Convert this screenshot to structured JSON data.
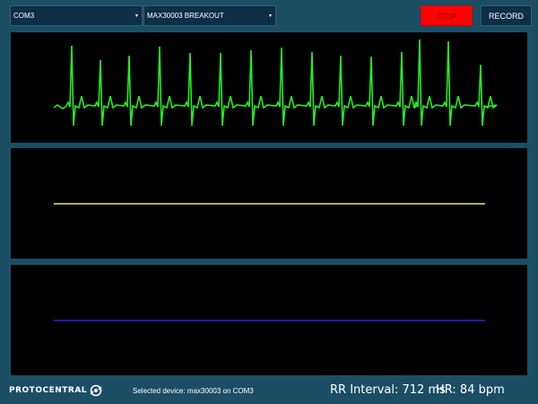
{
  "toolbar": {
    "port_select": {
      "value": "COM3"
    },
    "board_select": {
      "value": "MAX30003 BREAKOUT"
    },
    "stop_label": "STOP",
    "record_label": "RECORD"
  },
  "plots": {
    "ecg_color": "#22ee22",
    "trace2_color": "#e8e85a",
    "trace3_color": "#1a1aa8"
  },
  "footer": {
    "logo_text": "PROTOCENTRAL",
    "status": "Selected device: max30003 on COM3",
    "rr_interval": "RR Interval: 712 ms",
    "heart_rate": "HR: 84 bpm"
  },
  "colors": {
    "background": "#1b4e65",
    "stop_button": "#ff0000",
    "panel_bg": "#000000"
  }
}
